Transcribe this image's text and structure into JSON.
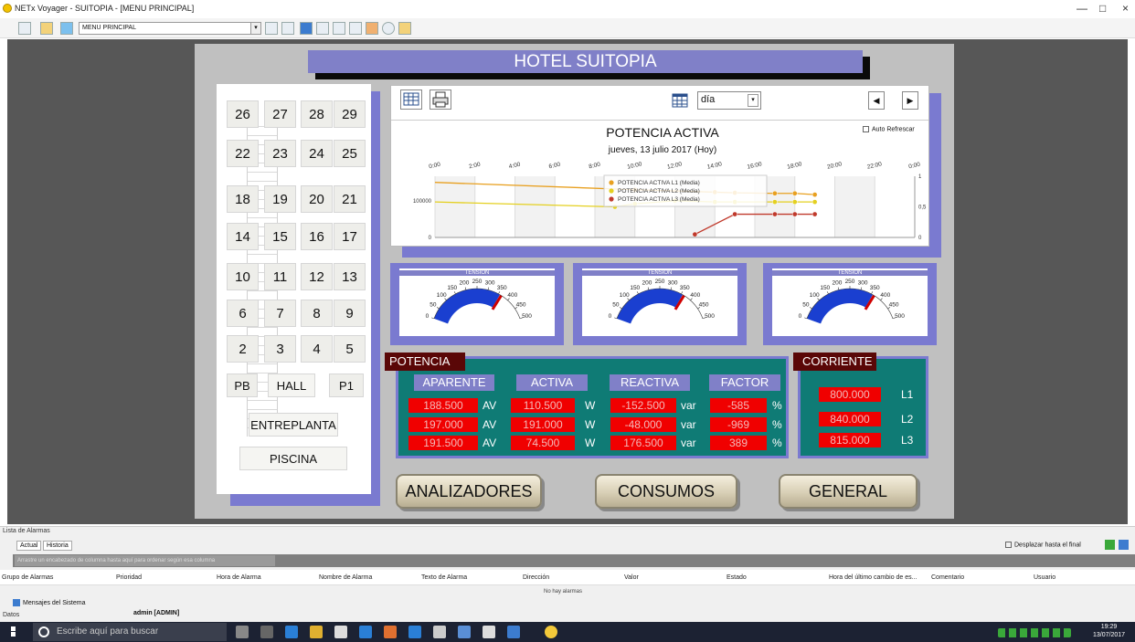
{
  "window": {
    "title": "NETx Voyager - SUITOPIA - [MENU PRINCIPAL]",
    "minimize": "—",
    "maximize": "□",
    "close": "×"
  },
  "toolbar": {
    "menu_select_value": "MENU PRINCIPAL",
    "select_arrow": "▾"
  },
  "hotel": {
    "title": "HOTEL SUITOPIA"
  },
  "floors": {
    "rows": [
      [
        "26",
        "27",
        "28",
        "29"
      ],
      [
        "22",
        "23",
        "24",
        "25"
      ],
      [
        "18",
        "19",
        "20",
        "21"
      ],
      [
        "14",
        "15",
        "16",
        "17"
      ],
      [
        "10",
        "11",
        "12",
        "13"
      ],
      [
        "6",
        "7",
        "8",
        "9"
      ],
      [
        "2",
        "3",
        "4",
        "5"
      ]
    ],
    "pb": "PB",
    "hall": "HALL",
    "p1": "P1",
    "entreplanta": "ENTREPLANTA",
    "piscina": "PISCINA"
  },
  "chart_panel": {
    "period_value": "día",
    "prev": "◀",
    "next": "▶",
    "auto_refresh": "Auto Refrescar"
  },
  "chart_data": {
    "type": "line",
    "title": "POTENCIA ACTIVA",
    "subtitle": "jueves, 13 julio 2017 (Hoy)",
    "x_ticks": [
      "0:00",
      "2:00",
      "4:00",
      "6:00",
      "8:00",
      "10:00",
      "12:00",
      "14:00",
      "16:00",
      "18:00",
      "20:00",
      "22:00",
      "0:00"
    ],
    "x_range_hours": [
      0,
      24
    ],
    "y_left_ticks": [
      "100000",
      "0"
    ],
    "y_right_ticks": [
      "1",
      "0,5",
      "0"
    ],
    "series": [
      {
        "name": "POTENCIA ACTIVA L1 (Media)",
        "color": "#e8a020",
        "points": [
          [
            0,
            0.9
          ],
          [
            10,
            0.78
          ],
          [
            14,
            0.74
          ],
          [
            15,
            0.73
          ],
          [
            17,
            0.72
          ],
          [
            18,
            0.72
          ],
          [
            19,
            0.7
          ]
        ]
      },
      {
        "name": "POTENCIA ACTIVA L2 (Media)",
        "color": "#e4d020",
        "points": [
          [
            0,
            0.58
          ],
          [
            9,
            0.5
          ],
          [
            10,
            0.55
          ],
          [
            12,
            0.6
          ],
          [
            14,
            0.58
          ],
          [
            15,
            0.58
          ],
          [
            17,
            0.58
          ],
          [
            18,
            0.58
          ],
          [
            19,
            0.58
          ]
        ]
      },
      {
        "name": "POTENCIA ACTIVA L3 (Media)",
        "color": "#c0392b",
        "points": [
          [
            13,
            0.05
          ],
          [
            15,
            0.38
          ],
          [
            17,
            0.38
          ],
          [
            18,
            0.38
          ],
          [
            19,
            0.38
          ]
        ]
      }
    ]
  },
  "gauges": [
    {
      "label": "TENSIÓN",
      "ticks": [
        "0",
        "50",
        "100",
        "150",
        "200",
        "250",
        "300",
        "350",
        "400",
        "450",
        "500"
      ]
    },
    {
      "label": "TENSIÓN",
      "ticks": [
        "0",
        "50",
        "100",
        "150",
        "200",
        "250",
        "300",
        "350",
        "400",
        "450",
        "500"
      ]
    },
    {
      "label": "TENSIÓN",
      "ticks": [
        "0",
        "50",
        "100",
        "150",
        "200",
        "250",
        "300",
        "350",
        "400",
        "450",
        "500"
      ]
    }
  ],
  "potencia": {
    "label": "POTENCIA",
    "headers": [
      "APARENTE",
      "ACTIVA",
      "REACTIVA",
      "FACTOR"
    ],
    "rows": [
      {
        "aparente": "188.500",
        "u1": "AV",
        "activa": "110.500",
        "u2": "W",
        "reactiva": "-152.500",
        "u3": "var",
        "factor": "-585",
        "u4": "%"
      },
      {
        "aparente": "197.000",
        "u1": "AV",
        "activa": "191.000",
        "u2": "W",
        "reactiva": "-48.000",
        "u3": "var",
        "factor": "-969",
        "u4": "%"
      },
      {
        "aparente": "191.500",
        "u1": "AV",
        "activa": "74.500",
        "u2": "W",
        "reactiva": "176.500",
        "u3": "var",
        "factor": "389",
        "u4": "%"
      }
    ]
  },
  "corriente": {
    "label": "CORRIENTE",
    "rows": [
      {
        "value": "800.000",
        "phase": "L1"
      },
      {
        "value": "840.000",
        "phase": "L2"
      },
      {
        "value": "815.000",
        "phase": "L3"
      }
    ]
  },
  "nav_buttons": {
    "analizadores": "ANALIZADORES",
    "consumos": "CONSUMOS",
    "general": "GENERAL"
  },
  "alarms": {
    "title": "Lista de Alarmas",
    "tab_actual": "Actual",
    "tab_historia": "Historia",
    "scroll_to_end": "Desplazar hasta el final",
    "group_hint": "Arrastre un encabezado de columna hasta aquí para ordenar según esa columna",
    "columns": [
      "Grupo de Alarmas",
      "Prioridad",
      "Hora de Alarma",
      "Nombre de Alarma",
      "Texto de Alarma",
      "Dirección",
      "Valor",
      "Estado",
      "Hora del último cambio de es...",
      "Comentario",
      "Usuario"
    ],
    "empty": "No hay alarmas",
    "system_messages": "Mensajes del Sistema",
    "datos": "Datos",
    "user": "admin [ADMIN]"
  },
  "taskbar": {
    "search_placeholder": "Escribe aquí para buscar",
    "time": "19:29",
    "date": "13/07/2017"
  }
}
